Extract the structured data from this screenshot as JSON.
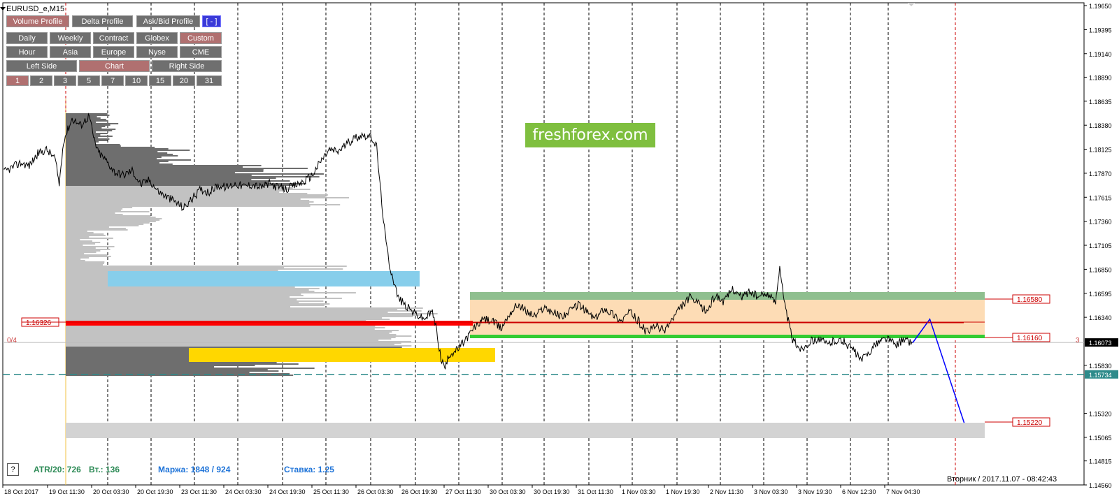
{
  "window": {
    "symbol_title": "EURUSD_e,M15"
  },
  "toolbar": {
    "profile_tabs": [
      {
        "label": "Volume Profile",
        "active": true
      },
      {
        "label": "Delta Profile",
        "active": false
      },
      {
        "label": "Ask/Bid Profile",
        "active": false
      },
      {
        "label": "[ - ]",
        "active": false
      }
    ],
    "period_row": [
      {
        "label": "Daily",
        "active": false
      },
      {
        "label": "Weekly",
        "active": false
      },
      {
        "label": "Contract",
        "active": false
      },
      {
        "label": "Globex",
        "active": false
      },
      {
        "label": "Custom",
        "active": true
      }
    ],
    "session_row": [
      {
        "label": "Hour",
        "active": false
      },
      {
        "label": "Asia",
        "active": false
      },
      {
        "label": "Europe",
        "active": false
      },
      {
        "label": "Nyse",
        "active": false
      },
      {
        "label": "CME",
        "active": false
      }
    ],
    "position_row": [
      {
        "label": "Left Side",
        "active": false
      },
      {
        "label": "Chart",
        "active": true
      },
      {
        "label": "Right Side",
        "active": false
      }
    ],
    "count_row": [
      {
        "label": "1",
        "active": true
      },
      {
        "label": "2",
        "active": false
      },
      {
        "label": "3",
        "active": false
      },
      {
        "label": "5",
        "active": false
      },
      {
        "label": "7",
        "active": false
      },
      {
        "label": "10",
        "active": false
      },
      {
        "label": "15",
        "active": false
      },
      {
        "label": "20",
        "active": false
      },
      {
        "label": "31",
        "active": false
      }
    ]
  },
  "watermark": "freshforex.com",
  "status_bar": {
    "atr_text": "ATR/20: 726",
    "vt_text": "Вт.: 136",
    "margin_text": "Маржа: 1848 / 924",
    "rate_text": "Ставка: 1.25",
    "help_label": "?",
    "datetime_text": "Вторник  /  2017.11.07  -  08:42:43",
    "left_marker": "0/4",
    "right_marker": "3"
  },
  "colors": {
    "grid": "#000000",
    "price_line": "#000000",
    "profile_dark": "#6e6e6e",
    "profile_light": "#c2c2c2",
    "poc_red": "#ff0000",
    "blue_zone": "#87ceeb",
    "yellow_zone": "#ffd700",
    "orange_zone": "#fddcb5",
    "green_zone": "#8fbf8f",
    "green_line": "#33cc33",
    "gray_zone": "#d3d3d3",
    "forecast_line": "#0000ff",
    "dashed_level": "#2e8b8b"
  },
  "chart_data": {
    "type": "line",
    "title": "EURUSD_e,M15",
    "y_ticks": [
      "1.19650",
      "1.19395",
      "1.19140",
      "1.18890",
      "1.18635",
      "1.18380",
      "1.18125",
      "1.17870",
      "1.17615",
      "1.17360",
      "1.17105",
      "1.16850",
      "1.16595",
      "1.16340",
      "1.16073",
      "1.15830",
      "1.15734",
      "1.15320",
      "1.15065",
      "1.14815",
      "1.14560"
    ],
    "ylim": [
      1.1456,
      1.1968
    ],
    "x_ticks": [
      "18 Oct 2017",
      "19 Oct 11:30",
      "20 Oct 03:30",
      "20 Oct 19:30",
      "23 Oct 11:30",
      "24 Oct 03:30",
      "24 Oct 19:30",
      "25 Oct 11:30",
      "26 Oct 03:30",
      "26 Oct 19:30",
      "27 Oct 11:30",
      "30 Oct 03:30",
      "30 Oct 19:30",
      "31 Oct 11:30",
      "1 Nov 03:30",
      "1 Nov 19:30",
      "2 Nov 11:30",
      "3 Nov 03:30",
      "3 Nov 19:30",
      "6 Nov 12:30",
      "7 Nov 04:30"
    ],
    "current_price": "1.16073",
    "dashed_level_price": "1.15734",
    "levels": [
      {
        "label": "1.16580",
        "value": 1.1658
      },
      {
        "label": "1.16160",
        "value": 1.1616
      },
      {
        "label": "1.15220",
        "value": 1.1522
      },
      {
        "label": "1.16326",
        "value": 1.16326
      }
    ],
    "price_series": [
      [
        0,
        1.1788
      ],
      [
        2,
        1.1793
      ],
      [
        4,
        1.1798
      ],
      [
        6,
        1.1795
      ],
      [
        8,
        1.1808
      ],
      [
        10,
        1.1812
      ],
      [
        12,
        1.1803
      ],
      [
        13,
        1.1775
      ],
      [
        14,
        1.1822
      ],
      [
        16,
        1.1845
      ],
      [
        18,
        1.1838
      ],
      [
        20,
        1.1848
      ],
      [
        21,
        1.1825
      ],
      [
        22,
        1.181
      ],
      [
        24,
        1.18
      ],
      [
        26,
        1.1788
      ],
      [
        28,
        1.1785
      ],
      [
        30,
        1.179
      ],
      [
        32,
        1.1775
      ],
      [
        34,
        1.178
      ],
      [
        36,
        1.1768
      ],
      [
        38,
        1.1762
      ],
      [
        40,
        1.1757
      ],
      [
        42,
        1.175
      ],
      [
        44,
        1.176
      ],
      [
        46,
        1.177
      ],
      [
        48,
        1.1767
      ],
      [
        50,
        1.1774
      ],
      [
        52,
        1.1772
      ],
      [
        54,
        1.1776
      ],
      [
        56,
        1.1773
      ],
      [
        58,
        1.1775
      ],
      [
        60,
        1.1772
      ],
      [
        62,
        1.1776
      ],
      [
        64,
        1.1772
      ],
      [
        66,
        1.177
      ],
      [
        68,
        1.1774
      ],
      [
        70,
        1.1778
      ],
      [
        72,
        1.1785
      ],
      [
        74,
        1.18
      ],
      [
        76,
        1.1812
      ],
      [
        78,
        1.181
      ],
      [
        80,
        1.1818
      ],
      [
        82,
        1.1825
      ],
      [
        84,
        1.1828
      ],
      [
        86,
        1.1824
      ],
      [
        87,
        1.1815
      ],
      [
        88,
        1.1765
      ],
      [
        89,
        1.172
      ],
      [
        90,
        1.169
      ],
      [
        92,
        1.1655
      ],
      [
        94,
        1.1645
      ],
      [
        96,
        1.1638
      ],
      [
        98,
        1.1632
      ],
      [
        100,
        1.164
      ],
      [
        101,
        1.162
      ],
      [
        102,
        1.159
      ],
      [
        103,
        1.158
      ],
      [
        104,
        1.1595
      ],
      [
        106,
        1.16
      ],
      [
        108,
        1.1612
      ],
      [
        110,
        1.1624
      ],
      [
        112,
        1.1632
      ],
      [
        114,
        1.163
      ],
      [
        116,
        1.1622
      ],
      [
        118,
        1.1638
      ],
      [
        120,
        1.1648
      ],
      [
        122,
        1.164
      ],
      [
        124,
        1.1635
      ],
      [
        126,
        1.1645
      ],
      [
        128,
        1.164
      ],
      [
        130,
        1.1635
      ],
      [
        132,
        1.164
      ],
      [
        134,
        1.1648
      ],
      [
        136,
        1.164
      ],
      [
        138,
        1.1632
      ],
      [
        140,
        1.1644
      ],
      [
        142,
        1.1638
      ],
      [
        144,
        1.163
      ],
      [
        146,
        1.164
      ],
      [
        148,
        1.163
      ],
      [
        150,
        1.1618
      ],
      [
        152,
        1.1625
      ],
      [
        154,
        1.162
      ],
      [
        156,
        1.1632
      ],
      [
        158,
        1.1645
      ],
      [
        160,
        1.1655
      ],
      [
        162,
        1.1648
      ],
      [
        164,
        1.164
      ],
      [
        166,
        1.1658
      ],
      [
        168,
        1.165
      ],
      [
        170,
        1.1665
      ],
      [
        172,
        1.1655
      ],
      [
        174,
        1.1662
      ],
      [
        176,
        1.1655
      ],
      [
        178,
        1.166
      ],
      [
        180,
        1.165
      ],
      [
        181,
        1.169
      ],
      [
        182,
        1.165
      ],
      [
        183,
        1.163
      ],
      [
        184,
        1.161
      ],
      [
        186,
        1.16
      ],
      [
        188,
        1.1608
      ],
      [
        190,
        1.1612
      ],
      [
        192,
        1.1605
      ],
      [
        194,
        1.161
      ],
      [
        196,
        1.1608
      ],
      [
        198,
        1.16
      ],
      [
        200,
        1.1588
      ],
      [
        202,
        1.1598
      ],
      [
        204,
        1.1608
      ],
      [
        206,
        1.1612
      ],
      [
        208,
        1.1605
      ],
      [
        210,
        1.161
      ],
      [
        212,
        1.1607
      ]
    ],
    "forecast_path": [
      [
        212,
        1.1607
      ],
      [
        216,
        1.1632
      ],
      [
        224,
        1.1522
      ]
    ]
  }
}
